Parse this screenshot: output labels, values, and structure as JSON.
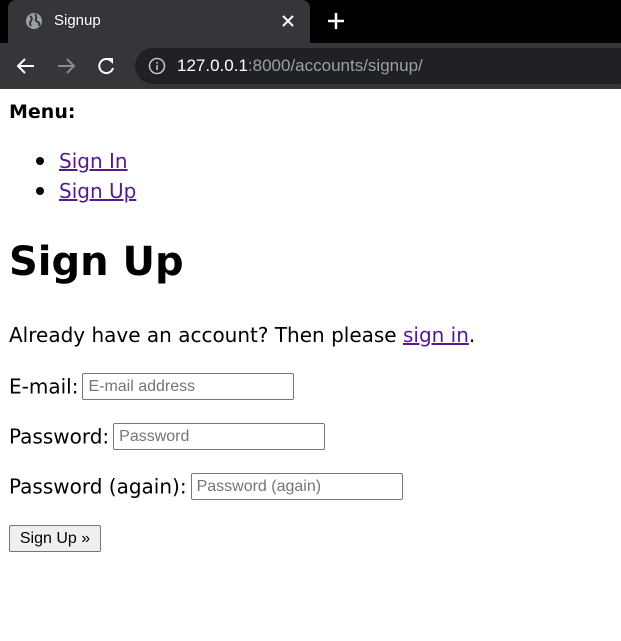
{
  "browser": {
    "tab_title": "Signup",
    "url_host": "127.0.0.1",
    "url_path": ":8000/accounts/signup/"
  },
  "menu": {
    "title": "Menu:",
    "items": [
      {
        "label": "Sign In"
      },
      {
        "label": "Sign Up"
      }
    ]
  },
  "page": {
    "heading": "Sign Up",
    "already_text": "Already have an account? Then please ",
    "sign_in_link": "sign in",
    "already_suffix": "."
  },
  "form": {
    "email": {
      "label": "E-mail:",
      "placeholder": "E-mail address",
      "value": ""
    },
    "password": {
      "label": "Password:",
      "placeholder": "Password",
      "value": ""
    },
    "password2": {
      "label": "Password (again):",
      "placeholder": "Password (again)",
      "value": ""
    },
    "submit_label": "Sign Up »"
  }
}
